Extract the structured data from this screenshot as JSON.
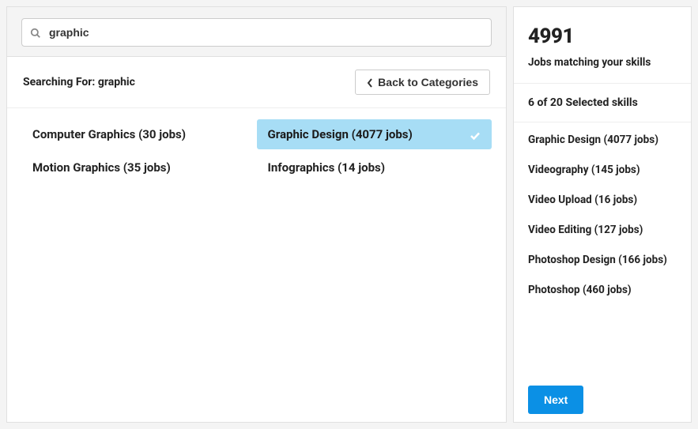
{
  "search": {
    "value": "graphic",
    "placeholder": "graphic",
    "searching_for_label": "Searching For: graphic"
  },
  "back_button": {
    "label": "Back to Categories"
  },
  "results": [
    {
      "label": "Computer Graphics (30 jobs)",
      "selected": false
    },
    {
      "label": "Graphic Design (4077 jobs)",
      "selected": true
    },
    {
      "label": "Motion Graphics (35 jobs)",
      "selected": false
    },
    {
      "label": "Infographics (14 jobs)",
      "selected": false
    }
  ],
  "sidebar": {
    "count": "4991",
    "count_sub": "Jobs matching your skills",
    "selected_heading": "6 of 20 Selected skills",
    "skills": [
      "Graphic Design (4077 jobs)",
      "Videography (145 jobs)",
      "Video Upload (16 jobs)",
      "Video Editing (127 jobs)",
      "Photoshop Design (166 jobs)",
      "Photoshop (460 jobs)"
    ],
    "next_label": "Next"
  }
}
